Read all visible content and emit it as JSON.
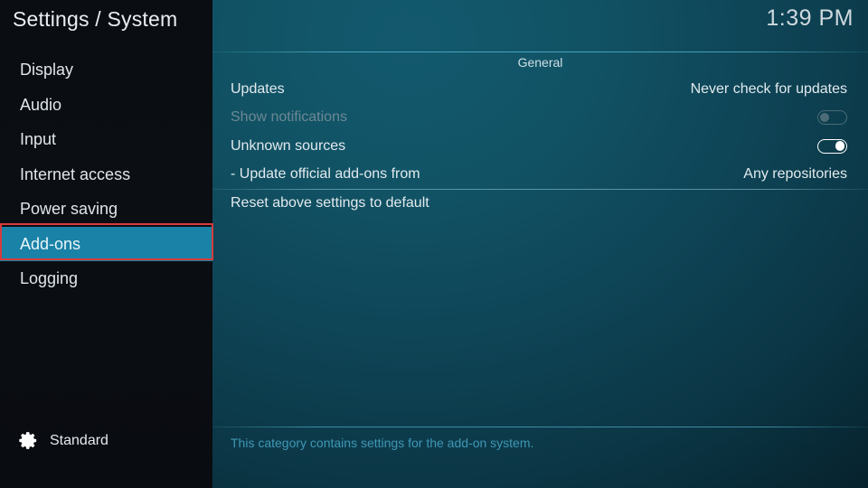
{
  "header": {
    "title": "Settings / System",
    "clock": "1:39 PM"
  },
  "colors": {
    "accent": "#1a82a6",
    "annotation": "#d63b3b",
    "panel_teal": "#0e4557",
    "sidebar_dark": "#0a0d12",
    "footer_text": "#3f97b5",
    "disabled_text": "#6c8894"
  },
  "sidebar": {
    "items": [
      {
        "label": "Display",
        "selected": false
      },
      {
        "label": "Audio",
        "selected": false
      },
      {
        "label": "Input",
        "selected": false
      },
      {
        "label": "Internet access",
        "selected": false
      },
      {
        "label": "Power saving",
        "selected": false
      },
      {
        "label": "Add-ons",
        "selected": true
      },
      {
        "label": "Logging",
        "selected": false
      }
    ],
    "footer": {
      "icon": "gear-icon",
      "level_label": "Standard"
    }
  },
  "main": {
    "section_title": "General",
    "rows": [
      {
        "label": "Updates",
        "control": "text",
        "value": "Never check for updates",
        "disabled": false,
        "separated": false
      },
      {
        "label": "Show notifications",
        "control": "toggle",
        "toggle_state": "off",
        "disabled": true,
        "separated": false
      },
      {
        "label": "Unknown sources",
        "control": "toggle",
        "toggle_state": "on",
        "disabled": false,
        "separated": false
      },
      {
        "label": "- Update official add-ons from",
        "control": "text",
        "value": "Any repositories",
        "disabled": false,
        "separated": false
      },
      {
        "label": "Reset above settings to default",
        "control": "none",
        "value": "",
        "disabled": false,
        "separated": true
      }
    ],
    "description": "This category contains settings for the add-on system."
  }
}
